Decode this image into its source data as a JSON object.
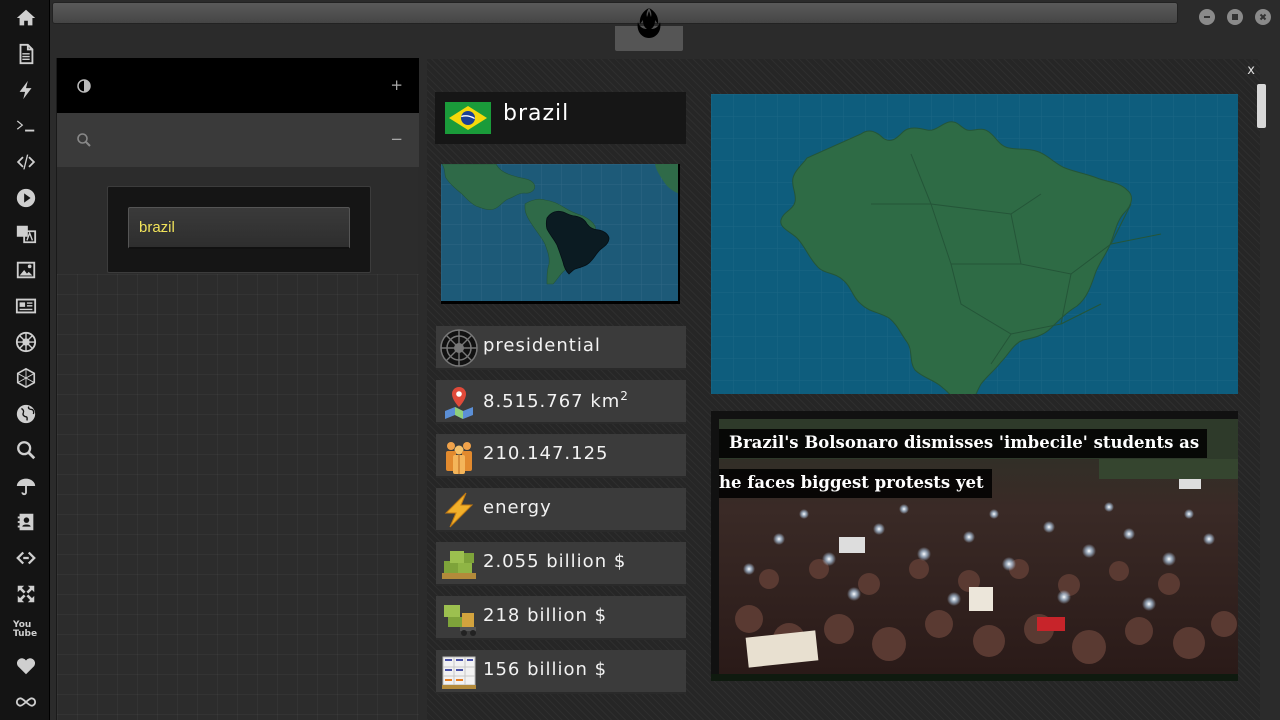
{
  "rail": {
    "icons": [
      "home-icon",
      "document-icon",
      "lightning-icon",
      "terminal-icon",
      "code-icon",
      "play-icon",
      "translate-icon",
      "image-icon",
      "newspaper-icon",
      "empire-icon",
      "network-icon",
      "globe-icon",
      "search-icon",
      "umbrella-icon",
      "contacts-icon",
      "links-icon",
      "expand-icon",
      "youtube-icon",
      "heart-icon",
      "infinity-icon"
    ],
    "youtube_label": "You Tube"
  },
  "window": {
    "close_label": "x"
  },
  "left_panel": {
    "plus_label": "+",
    "minus_label": "−",
    "search_value": "brazil",
    "search_placeholder": ""
  },
  "country": {
    "name": "brazil",
    "government": "presidential",
    "area": "8.515.767 km",
    "area_unit_sup": "2",
    "population": "210.147.125",
    "main_sector": "energy",
    "gdp": "2.055 billion $",
    "exports": "218 billion $",
    "imports": "156 billion $"
  },
  "news": {
    "headline_line1": "Brazil's Bolsonaro dismisses 'imbecile' students as",
    "headline_line2": "he faces biggest protests yet"
  },
  "colors": {
    "accent_text": "#f1e35a",
    "map_ocean": "#0e5d7d",
    "map_land": "#2e6b45"
  }
}
